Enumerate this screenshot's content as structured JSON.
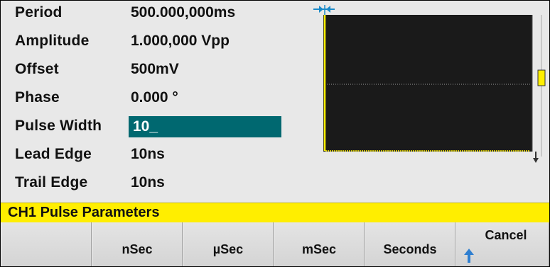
{
  "params": [
    {
      "label": "Period",
      "value": "500.000,000ms"
    },
    {
      "label": "Amplitude",
      "value": "1.000,000 Vpp"
    },
    {
      "label": "Offset",
      "value": "500mV"
    },
    {
      "label": "Phase",
      "value": "0.000 °"
    },
    {
      "label": "Pulse Width",
      "value": "10_",
      "active": true
    },
    {
      "label": "Lead Edge",
      "value": "10ns"
    },
    {
      "label": "Trail Edge",
      "value": "10ns"
    }
  ],
  "title": "CH1 Pulse Parameters",
  "softkeys": [
    {
      "label": ""
    },
    {
      "label": "nSec"
    },
    {
      "label": "µSec"
    },
    {
      "label": "mSec"
    },
    {
      "label": "Seconds"
    },
    {
      "label": "Cancel"
    }
  ],
  "colors": {
    "screen_bg": "#e8e8e8",
    "active_field_bg": "#006870",
    "title_bar": "#ffee00",
    "waveform": "#ffee00",
    "width_marker": "#1a8ac9",
    "scope_bg": "#1a1a1a"
  },
  "icons": {
    "width_marker": "pulse-width-marker-icon",
    "cancel_arrow": "up-arrow-icon"
  }
}
